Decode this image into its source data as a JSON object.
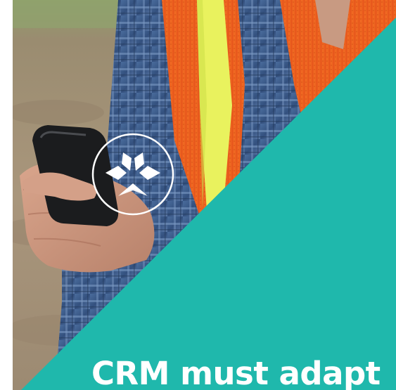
{
  "headline": "CRM must adapt",
  "logo_icon": "arrows-converging-icon",
  "colors": {
    "accent_teal": "#1fb8ac",
    "vest_orange": "#f0641e",
    "vest_stripe": "#e6f05a",
    "shirt_blue": "#3d5f8f",
    "ground": "#a08e76",
    "text": "#ffffff"
  }
}
